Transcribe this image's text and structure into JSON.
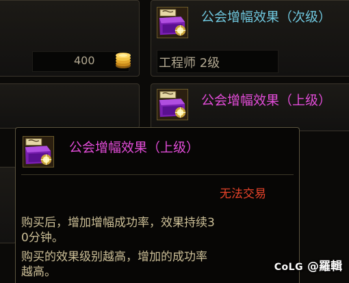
{
  "items": [
    {
      "title": "公会增幅效果（次级）",
      "requirement": "工程师 2级",
      "title_color": "#6fc7de"
    },
    {
      "title": "公会增幅效果（上级）",
      "title_color": "#e24cd8"
    }
  ],
  "price": {
    "amount": "400",
    "icon": "gold-coin-icon"
  },
  "tooltip": {
    "title": "公会增幅效果（上级）",
    "trade_status": "无法交易",
    "description_lines": [
      "购买后，增加增幅成功率，效果持续3",
      "0分钟。",
      "购买的效果级别越高，增加的成功率",
      "越高。"
    ]
  },
  "watermark": {
    "logo": "CoLG",
    "user": "@羅輯"
  },
  "colors": {
    "cyan_title": "#6fc7de",
    "magenta_title": "#e24cd8",
    "red_status": "#e8432a",
    "body_text": "#ccbf97"
  }
}
